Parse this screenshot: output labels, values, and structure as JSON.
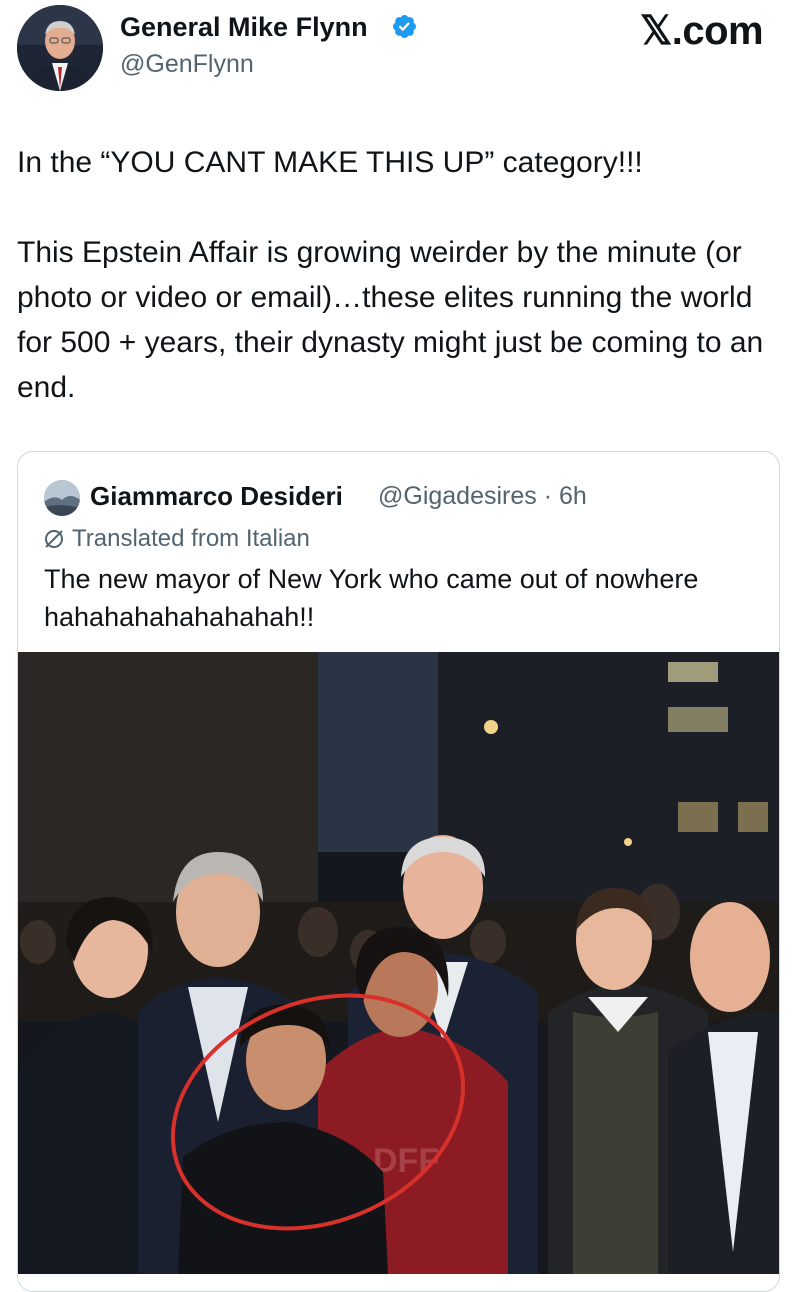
{
  "author": {
    "name": "General Mike Flynn",
    "handle": "@GenFlynn",
    "verified_icon": "verified-badge-icon",
    "avatar_icon": "user-avatar"
  },
  "site_mark": "𝕏.com",
  "tweet": {
    "text": "In the “YOU CANT MAKE THIS UP” category!!!\n\nThis Epstein Affair is growing weirder by the minute (or photo or video or email)…these elites running the world for 500 + years, their dynasty might just be coming to an end."
  },
  "quote": {
    "name": "Giammarco Desideri",
    "meta": "@Gigadesires · 6h",
    "translated_label": "Translated from Italian",
    "translated_icon": "translate-icon",
    "text": "The new mayor of New York who came out of nowhere hahahahahahahahah!!",
    "photo": {
      "description_icon": "group-photo",
      "shirt_text": "DFF"
    }
  },
  "colors": {
    "text_primary": "#0f1419",
    "text_secondary": "#536471",
    "verified_blue": "#1d9bf0",
    "border": "#cfd9de",
    "circle_red": "#d8302a"
  }
}
